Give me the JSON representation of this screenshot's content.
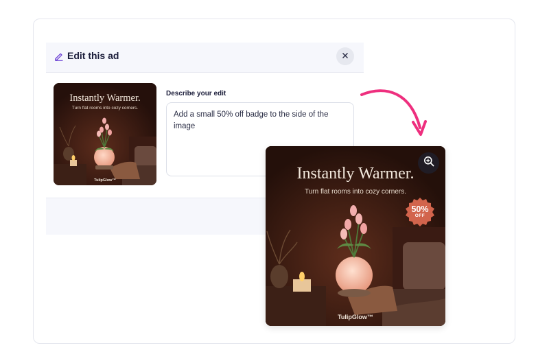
{
  "modal": {
    "title": "Edit this ad",
    "field_label": "Describe your edit",
    "edit_prompt": "Add a small 50% off badge to the side of the image"
  },
  "original_ad": {
    "headline": "Instantly Warmer.",
    "subheadline": "Turn flat rooms into cozy corners.",
    "brand": "TulipGlow™"
  },
  "edited_ad": {
    "headline": "Instantly Warmer.",
    "subheadline": "Turn flat rooms into cozy corners.",
    "brand": "TulipGlow™",
    "badge_percent": "50%",
    "badge_text": "OFF"
  },
  "icons": {
    "header": "pencil-icon",
    "close": "close-icon",
    "zoom": "zoom-in-icon",
    "flow": "curved-arrow-icon"
  },
  "colors": {
    "accent_purple": "#6b3fd4",
    "arrow_pink": "#ee2f7e",
    "badge_red": "#d2644c",
    "ad_background": "#2c120d"
  }
}
